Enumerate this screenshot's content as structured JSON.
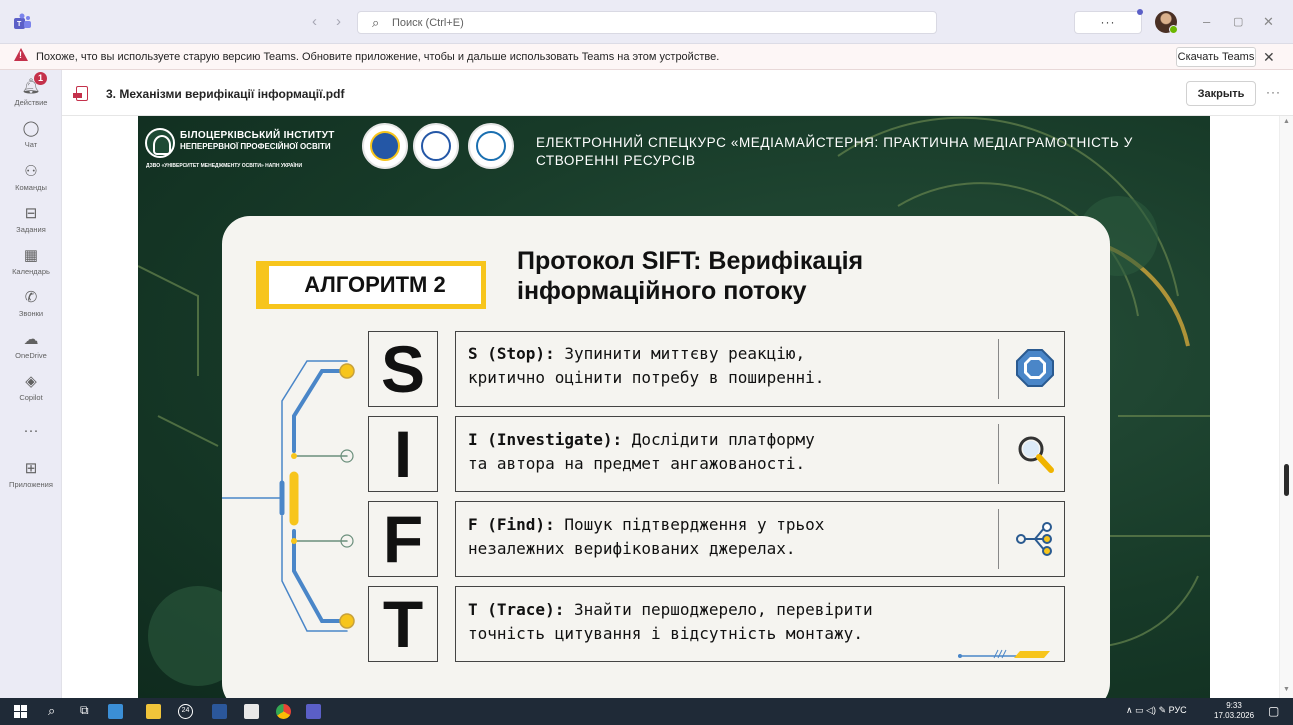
{
  "titlebar": {
    "search_placeholder": "Поиск (Ctrl+E)",
    "more_label": "···",
    "back_icon": "chevron-left-icon",
    "forward_icon": "chevron-right-icon"
  },
  "banner": {
    "message": "Похоже, что вы используете старую версию Teams. Обновите приложение, чтобы и дальше использовать Teams на этом устройстве.",
    "download_label": "Скачать Teams"
  },
  "rail": {
    "activity_badge": "1",
    "items": [
      {
        "label": "Действие",
        "icon": "bell-icon"
      },
      {
        "label": "Чат",
        "icon": "chat-icon"
      },
      {
        "label": "Команды",
        "icon": "teams-icon"
      },
      {
        "label": "Задания",
        "icon": "assignments-icon"
      },
      {
        "label": "Календарь",
        "icon": "calendar-icon"
      },
      {
        "label": "Звонки",
        "icon": "phone-icon"
      },
      {
        "label": "OneDrive",
        "icon": "cloud-icon"
      },
      {
        "label": "Copilot",
        "icon": "copilot-icon"
      },
      {
        "label": "",
        "icon": "more-icon"
      },
      {
        "label": "Приложения",
        "icon": "apps-icon"
      }
    ]
  },
  "file": {
    "name": "3. Механізми верифікації інформації.pdf",
    "close_label": "Закрыть",
    "more_label": "···"
  },
  "slide": {
    "institute_line1": "БІЛОЦЕРКІВСЬКИЙ ІНСТИТУТ",
    "institute_line2": "НЕПЕРЕРВНОЇ ПРОФЕСІЙНОЇ ОСВІТИ",
    "institute_sub": "ДЗВО «УНІВЕРСИТЕТ МЕНЕДЖМЕНТУ ОСВІТИ» НАПН УКРАЇНИ",
    "course_title": "ЕЛЕКТРОННИЙ СПЕЦКУРС «МЕДІАМАЙСТЕРНЯ: ПРАКТИЧНА МЕДІАГРАМОТНІСТЬ У СТВОРЕННІ РЕСУРСІВ",
    "algorithm_label": "АЛГОРИТМ 2",
    "protocol_title_line1": "Протокол SIFT: Верифікація",
    "protocol_title_line2": "інформаційного потоку",
    "steps": [
      {
        "letter": "S",
        "term": "S (Stop):",
        "line1": " Зупинити миттєву реакцію,",
        "line2": "критично оцінити потребу в поширенні.",
        "icon": "stop-octagon-icon"
      },
      {
        "letter": "I",
        "term": "I (Investigate):",
        "line1": " Дослідити платформу",
        "line2": "та автора на предмет ангажованості.",
        "icon": "magnifier-icon"
      },
      {
        "letter": "F",
        "term": "F (Find):",
        "line1": " Пошук підтвердження у трьох",
        "line2": "незалежних верифікованих джерелах.",
        "icon": "branch-icon"
      },
      {
        "letter": "T",
        "term": "T (Trace):",
        "line1": " Знайти першоджерело, перевірити",
        "line2": "точність цитування і відсутність монтажу.",
        "icon": "trace-icon"
      }
    ],
    "colors": {
      "background": "#173a28",
      "card": "#f5f4f0",
      "accent_yellow": "#f7c51c",
      "accent_blue": "#4a86c8"
    }
  },
  "taskbar": {
    "tray_lang": "РУС",
    "time": "9:33",
    "date": "17.03.2026",
    "badge_24": "24"
  }
}
